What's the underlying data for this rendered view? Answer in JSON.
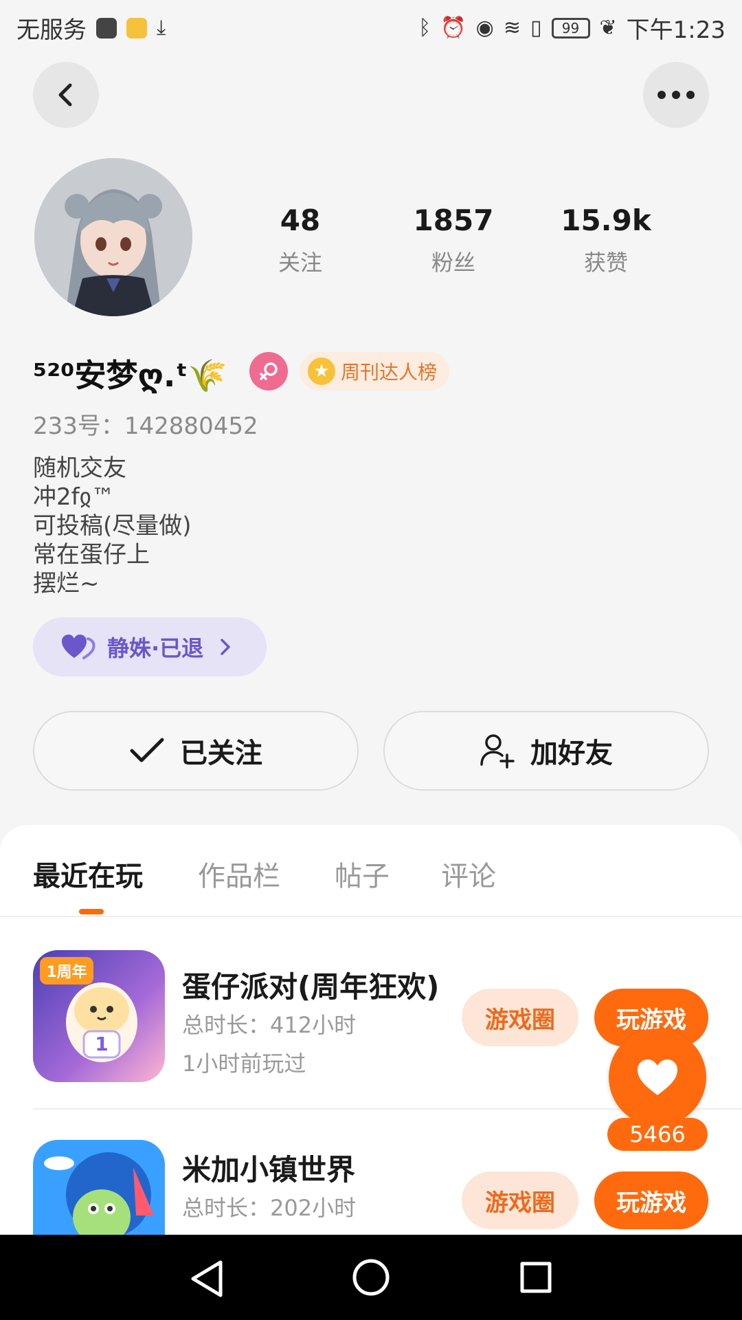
{
  "status_bar": {
    "carrier": "无服务",
    "time": "下午1:23",
    "battery": "99"
  },
  "profile": {
    "username": "⁵²⁰安梦ღ.ᵗ🌾",
    "rank_badge": "周刊达人榜",
    "uid_label": "233号：",
    "uid": "142880452",
    "bio": [
      "随机交友",
      "冲2fჲ™",
      "可投稿(尽量做)",
      "常在蛋仔上",
      "摆烂~"
    ],
    "guild": "静姝·已退",
    "stats": [
      {
        "value": "48",
        "label": "关注"
      },
      {
        "value": "1857",
        "label": "粉丝"
      },
      {
        "value": "15.9k",
        "label": "获赞"
      }
    ]
  },
  "actions": {
    "follow": "已关注",
    "add_friend": "加好友"
  },
  "tabs": [
    "最近在玩",
    "作品栏",
    "帖子",
    "评论"
  ],
  "games": [
    {
      "name": "蛋仔派对(周年狂欢)",
      "duration": "总时长：412小时",
      "last_played": "1小时前玩过",
      "circle_btn": "游戏圈",
      "play_btn": "玩游戏",
      "icon_badge": "1周年"
    },
    {
      "name": "米加小镇世界",
      "duration": "总时长：202小时",
      "last_played": "",
      "circle_btn": "游戏圈",
      "play_btn": "玩游戏"
    }
  ],
  "like": {
    "count": "5466"
  },
  "colors": {
    "accent": "#ff6a0e",
    "accent_soft": "#fde6d8",
    "guild_bg": "#e6e3f7",
    "guild_text": "#6b57c9"
  }
}
